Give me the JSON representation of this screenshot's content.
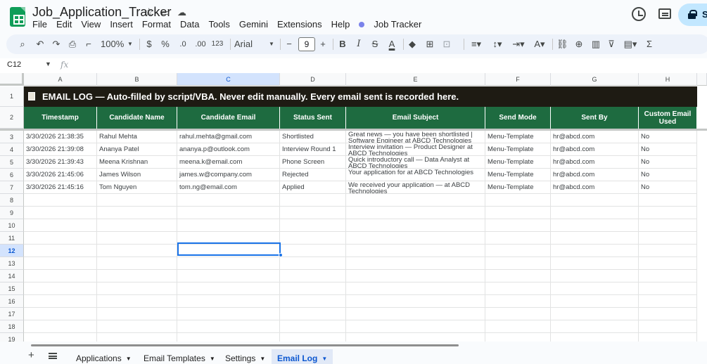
{
  "app": {
    "doc_title": "Job_Application_Tracker",
    "share_label": "Sh",
    "menu": [
      "File",
      "Edit",
      "View",
      "Insert",
      "Format",
      "Data",
      "Tools",
      "Gemini",
      "Extensions",
      "Help"
    ],
    "extension_menu": "Job Tracker"
  },
  "toolbar": {
    "zoom": "100%",
    "currency": "$",
    "percent": "%",
    "dec_decrease": ".0",
    "dec_increase": ".00",
    "more_formats": "123",
    "font": "Arial",
    "font_size": "9",
    "bold": "B",
    "italic": "I",
    "strike": "S",
    "text_color": "A",
    "sum": "Σ",
    "minus": "−",
    "plus": "+",
    "more_formats_label": "123"
  },
  "formula_bar": {
    "name_box": "C12",
    "fx": "fx"
  },
  "columns": [
    "A",
    "B",
    "C",
    "D",
    "E",
    "F",
    "G",
    "H"
  ],
  "selected_column": "C",
  "selected_row": 12,
  "rows": [
    "1",
    "2",
    "3",
    "4",
    "5",
    "6",
    "7",
    "8",
    "9",
    "10",
    "11",
    "12",
    "13",
    "14",
    "15",
    "16",
    "17",
    "18",
    "19"
  ],
  "banner": "EMAIL LOG  —  Auto-filled by script/VBA. Never edit manually. Every email sent is recorded here.",
  "headers": [
    "Timestamp",
    "Candidate Name",
    "Candidate Email",
    "Status Sent",
    "Email Subject",
    "Send Mode",
    "Sent By",
    "Custom Email Used"
  ],
  "data": [
    [
      "3/30/2026 21:38:35",
      "Rahul Mehta",
      "rahul.mehta@gmail.com",
      "Shortlisted",
      "Great news — you have been shortlisted | Software Engineer at ABCD Technologies",
      "Menu-Template",
      "hr@abcd.com",
      "No"
    ],
    [
      "3/30/2026 21:39:08",
      "Ananya Patel",
      "ananya.p@outlook.com",
      "Interview Round 1",
      "Interview invitation — Product Designer at ABCD Technologies",
      "Menu-Template",
      "hr@abcd.com",
      "No"
    ],
    [
      "3/30/2026 21:39:43",
      "Meena Krishnan",
      "meena.k@email.com",
      "Phone Screen",
      "Quick introductory call — Data Analyst at ABCD Technologies",
      "Menu-Template",
      "hr@abcd.com",
      "No"
    ],
    [
      "3/30/2026 21:45:06",
      "James Wilson",
      "james.w@company.com",
      "Rejected",
      "Your application for  at ABCD Technologies",
      "Menu-Template",
      "hr@abcd.com",
      "No"
    ],
    [
      "3/30/2026 21:45:16",
      "Tom Nguyen",
      "tom.ng@email.com",
      "Applied",
      "We received your application —  at ABCD Technologies",
      "Menu-Template",
      "hr@abcd.com",
      "No"
    ]
  ],
  "sheets": [
    {
      "label": "Applications",
      "active": false
    },
    {
      "label": "Email Templates",
      "active": false
    },
    {
      "label": "Settings",
      "active": false
    },
    {
      "label": "Email Log",
      "active": true
    }
  ],
  "colors": {
    "banner_bg": "#1e1b13",
    "header_bg": "#1e6b40",
    "selection": "#1a73e8",
    "active_tab": "#0b57d0"
  },
  "icons": [
    "sheets-logo",
    "star-icon",
    "move-folder-icon",
    "cloud-status-icon",
    "history-icon",
    "comments-icon",
    "lock-icon",
    "search-icon",
    "undo-icon",
    "redo-icon",
    "print-icon",
    "paint-format-icon",
    "fill-color-icon",
    "borders-icon",
    "merge-icon",
    "align-icon",
    "valign-icon",
    "wrap-icon",
    "rotate-icon",
    "link-icon",
    "comment-icon",
    "chart-icon",
    "filter-icon",
    "filter-views-icon",
    "functions-icon"
  ]
}
